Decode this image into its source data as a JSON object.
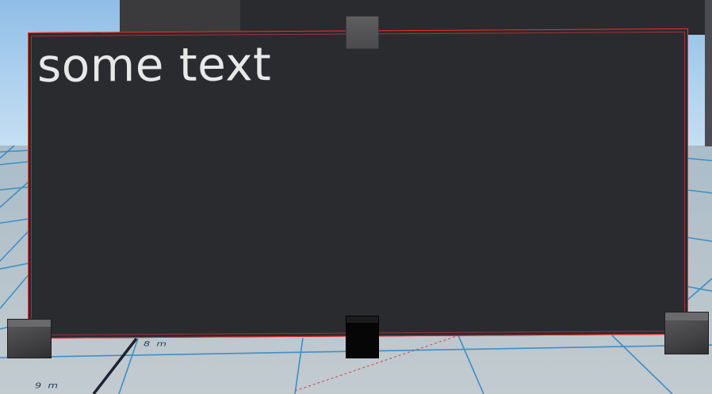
{
  "panel": {
    "text": "some text",
    "outline_color": "#ff2a2a",
    "background_color": "#2a2b2f",
    "text_color": "#e8e8e8"
  },
  "grid": {
    "labels": [
      "8 m",
      "9 m"
    ],
    "line_color": "#3f8fc4"
  },
  "handles": {
    "top": "resize-handle-top",
    "bottom_left": "resize-handle-bottom-left",
    "bottom_center": "move-handle-bottom-center",
    "bottom_right": "resize-handle-bottom-right"
  }
}
